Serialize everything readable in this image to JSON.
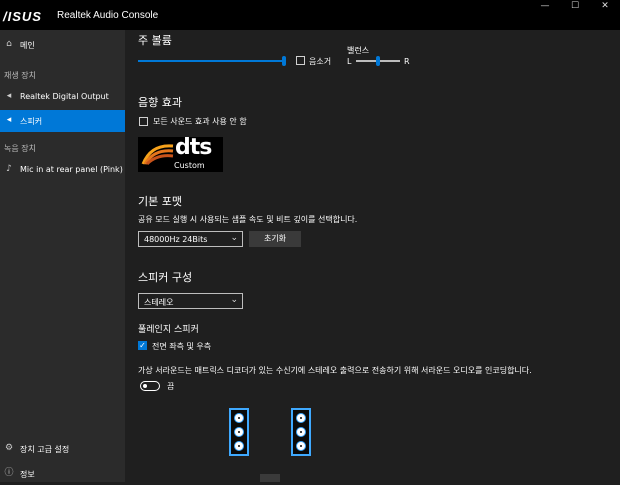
{
  "window": {
    "logo": "/ISUS",
    "title": "Realtek Audio Console",
    "buttons": [
      "—",
      "☐",
      "✕"
    ]
  },
  "sidebar": {
    "home": {
      "icon": "home-icon",
      "label": "메인"
    },
    "playback_header": "재생 장치",
    "playback_items": [
      {
        "icon": "speaker-icon",
        "label": "Realtek Digital Output"
      },
      {
        "icon": "speaker-icon",
        "label": "스피커",
        "active": true
      }
    ],
    "recording_header": "녹음 장치",
    "recording_items": [
      {
        "icon": "microphone-icon",
        "label": "Mic in at rear panel (Pink)"
      }
    ],
    "advanced": {
      "icon": "gear-icon",
      "label": "장치 고급 설정"
    },
    "info": {
      "icon": "info-icon",
      "label": "정보"
    }
  },
  "main_volume": {
    "title": "주 볼륨",
    "level": 1.0,
    "mute_label": "음소거",
    "mute_checked": false,
    "balance_label": "밸런스",
    "balance_left": "L",
    "balance_right": "R",
    "balance_value": 0.5
  },
  "sound_effects": {
    "title": "음향 효과",
    "disable_all_label": "모든 사운드 효과 사용 안 함",
    "disable_all_checked": false,
    "dts_logo_text": "dts",
    "dts_logo_sub": "Custom"
  },
  "default_format": {
    "title": "기본 포맷",
    "description": "공유 모드 실행 시 사용되는 샘플 속도 및 비트 깊이를 선택합니다.",
    "selected": "48000Hz 24Bits",
    "reset_label": "초기화"
  },
  "speaker_config": {
    "title": "스피커 구성",
    "selected": "스테레오"
  },
  "fullrange": {
    "title": "풀레인지 스피커",
    "front_label": "전면 좌측 및 우측",
    "front_checked": true
  },
  "virtual_surround": {
    "description": "가상 서라운드는 매트릭스 디코더가 있는 수신기에 스테레오 출력으로 전송하기 위해 서라운드 오디오를 인코딩합니다.",
    "toggle_on": false,
    "toggle_label": "끔"
  },
  "colors": {
    "accent": "#0078d7",
    "speaker_border": "#3fa9ff",
    "background": "#1f1f1f",
    "sidebar": "#2b2b2b"
  }
}
